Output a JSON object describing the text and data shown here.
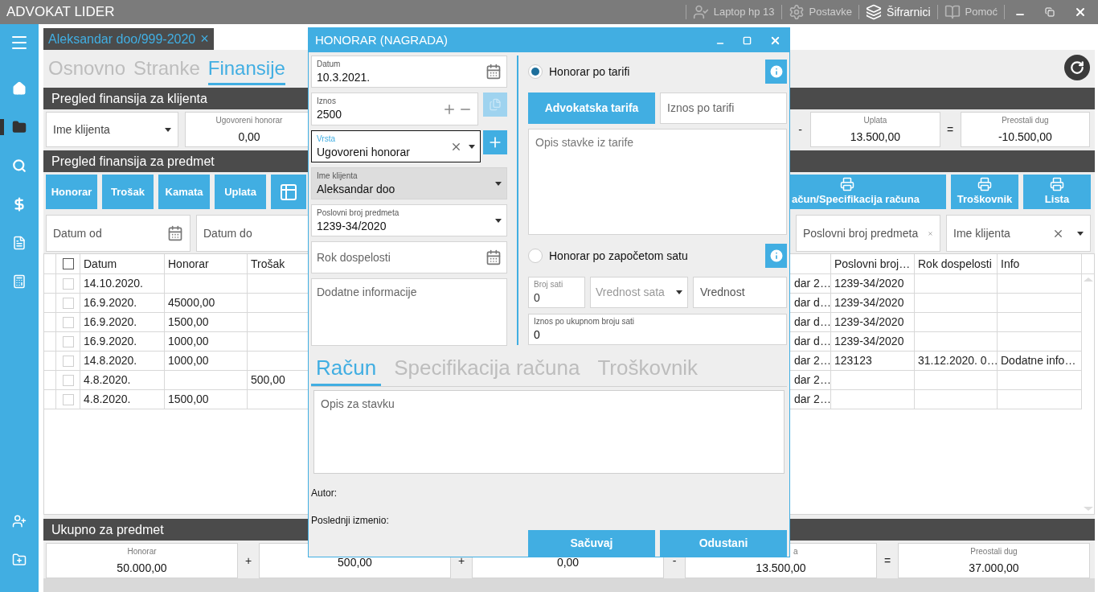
{
  "app_bar": {
    "title": "ADVOKAT LIDER",
    "items": [
      {
        "kind": "user",
        "label": "Laptop hp 13",
        "selected": false
      },
      {
        "kind": "settings",
        "label": "Postavke",
        "selected": false
      },
      {
        "kind": "codebooks",
        "label": "Šifrarnici",
        "selected": true
      },
      {
        "kind": "help",
        "label": "Pomoć",
        "selected": false
      }
    ]
  },
  "sidebar": {
    "top": [
      {
        "kind": "home",
        "selected": false
      },
      {
        "kind": "folder",
        "selected": true
      },
      {
        "kind": "search",
        "selected": false
      },
      {
        "kind": "dollar",
        "selected": false
      },
      {
        "kind": "document",
        "selected": false
      },
      {
        "kind": "calculator",
        "selected": false
      }
    ],
    "bottom": [
      {
        "kind": "user_add",
        "selected": false
      },
      {
        "kind": "folder_add",
        "selected": false
      }
    ]
  },
  "document_tab": {
    "label": "Aleksandar doo/999-2020",
    "close": "×"
  },
  "tabs": [
    {
      "label": "Osnovno",
      "selected": false
    },
    {
      "label": "Stranke",
      "selected": false
    },
    {
      "label": "Finansije",
      "selected": true
    }
  ],
  "client_section": {
    "title": "Pregled finansija za klijenta",
    "client_select": {
      "placeholder": "Ime klijenta"
    },
    "left": [
      {
        "kind": "total",
        "label": "Ugovoreni honorar",
        "value": "0,00"
      }
    ],
    "right": [
      {
        "kind": "op",
        "text": "-"
      },
      {
        "kind": "total",
        "label": "Uplata",
        "value": "13.500,00"
      },
      {
        "kind": "op",
        "text": "="
      },
      {
        "kind": "total",
        "label": "Preostali dug",
        "value": "-10.500,00"
      }
    ]
  },
  "case_section": {
    "title": "Pregled finansija za predmet",
    "actions": [
      {
        "kind": "text",
        "label": "Honorar"
      },
      {
        "kind": "text",
        "label": "Trošak"
      },
      {
        "kind": "text",
        "label": "Kamata"
      },
      {
        "kind": "text",
        "label": "Uplata"
      },
      {
        "kind": "icon"
      }
    ],
    "print_actions": [
      "ačun/Specifikacija računa",
      "Troškovnik",
      "Lista"
    ],
    "filters_left": [
      {
        "kind": "date",
        "placeholder": "Datum od"
      },
      {
        "kind": "plain",
        "placeholder": "Datum do"
      }
    ],
    "filters_right": [
      {
        "kind": "clear",
        "placeholder": "Poslovni broj predmeta"
      },
      {
        "kind": "clear_select",
        "placeholder": "Ime klijenta"
      }
    ]
  },
  "table": {
    "header_checked": false,
    "left_columns": [
      "Datum",
      "Honorar",
      "Trošak"
    ],
    "right_columns": [
      "Poslovni broj…",
      "Rok dospelosti",
      "Info"
    ],
    "rows": [
      {
        "checked": false,
        "date": "14.10.2020.",
        "column_5": "dar 2…",
        "case_no": "1239-34/2020"
      },
      {
        "checked": false,
        "date": "16.9.2020.",
        "fee": "45000,00",
        "column_5": "dar d…",
        "case_no": "1239-34/2020"
      },
      {
        "checked": false,
        "date": "16.9.2020.",
        "fee": "1500,00",
        "column_5": "dar d…",
        "case_no": "1239-34/2020"
      },
      {
        "checked": false,
        "date": "16.9.2020.",
        "fee": "1000,00",
        "column_5": "dar d…",
        "case_no": "1239-34/2020"
      },
      {
        "checked": false,
        "date": "14.8.2020.",
        "fee": "1000,00",
        "column_5": "dar 2…",
        "case_no": "123123",
        "due": "31.12.2020. 0…",
        "info": "Dodatne info…"
      },
      {
        "checked": false,
        "date": "4.8.2020.",
        "cost": "500,00",
        "column_5": "dar 2…"
      },
      {
        "checked": false,
        "date": "4.8.2020.",
        "fee": "1500,00",
        "column_5": "dar 2…"
      }
    ]
  },
  "summary": {
    "title": "Ukupno za predmet",
    "items": [
      {
        "kind": "total",
        "label": "Honorar",
        "value": "50.000,00"
      },
      {
        "kind": "op",
        "text": "+"
      },
      {
        "kind": "total",
        "value": "500,00"
      },
      {
        "kind": "op",
        "text": "+"
      },
      {
        "kind": "total",
        "value": "0,00"
      },
      {
        "kind": "op",
        "text": "-"
      },
      {
        "kind": "total_cut",
        "label": "a",
        "value": "13.500,00"
      },
      {
        "kind": "op",
        "text": "="
      },
      {
        "kind": "total",
        "label": "Preostali dug",
        "value": "37.000,00"
      }
    ]
  },
  "dialog": {
    "title": "HONORAR (NAGRADA)",
    "fields": [
      {
        "kind": "date",
        "label": "Datum",
        "value": "10.3.2021.",
        "focused": false,
        "disabled": false
      },
      {
        "kind": "amount",
        "label": "Iznos",
        "value": "2500",
        "focused": false,
        "disabled": false
      },
      {
        "kind": "combo",
        "label": "Vrsta",
        "value": "Ugovoreni honorar",
        "focused": true,
        "disabled": false
      },
      {
        "kind": "select",
        "label": "Ime klijenta",
        "value": "Aleksandar doo",
        "focused": false,
        "disabled": true
      },
      {
        "kind": "select",
        "label": "Poslovni broj predmeta",
        "value": "1239-34/2020",
        "focused": false,
        "disabled": false
      },
      {
        "kind": "date",
        "placeholder": "Rok dospelosti",
        "focused": false,
        "disabled": false
      },
      {
        "kind": "textarea",
        "placeholder": "Dodatne informacije",
        "focused": false,
        "disabled": false
      }
    ],
    "copy_button": {
      "disabled": true
    },
    "rate_options": [
      {
        "label": "Honorar po tarifi",
        "selected": true
      },
      {
        "label": "Honorar po započetom satu",
        "selected": false
      }
    ],
    "tariff": {
      "button": "Advokatska tarifa",
      "amount_placeholder": "Iznos po tarifi",
      "description_placeholder": "Opis stavke iz tarife"
    },
    "hourly": {
      "hours_label": "Broj sati",
      "hours_value": "0",
      "rate_placeholder": "Vrednost sata",
      "value_placeholder": "Vrednost",
      "total_label": "Iznos po ukupnom broju sati",
      "total_value": "0"
    },
    "tabs": [
      {
        "label": "Račun",
        "selected": true
      },
      {
        "label": "Specifikacija računa",
        "selected": false
      },
      {
        "label": "Troškovnik",
        "selected": false
      }
    ],
    "item_description_placeholder": "Opis za stavku",
    "author_label": "Autor:",
    "modified_label": "Poslednji izmenio:",
    "buttons": [
      "Sačuvaj",
      "Odustani"
    ]
  }
}
